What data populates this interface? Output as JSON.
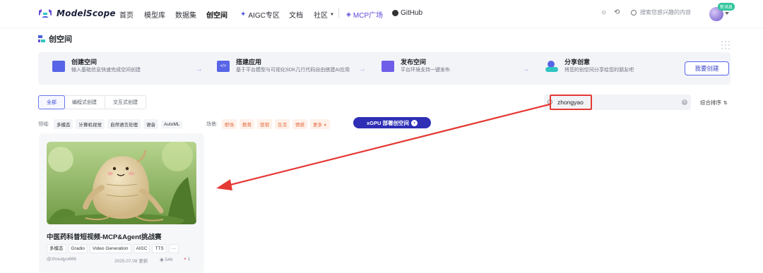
{
  "nav": {
    "brand": "ModelScope",
    "items": [
      {
        "label": "首页"
      },
      {
        "label": "模型库"
      },
      {
        "label": "数据集"
      },
      {
        "label": "创空间"
      },
      {
        "label": "AIGC专区"
      },
      {
        "label": "文档"
      },
      {
        "label": "社区"
      },
      {
        "label": "MCP广场"
      },
      {
        "label": "GitHub"
      }
    ],
    "search_placeholder": "搜索您感兴趣的内容",
    "new_badge": "新消息"
  },
  "page": {
    "title": "创空间"
  },
  "banner": {
    "steps": [
      {
        "title": "创建空间",
        "sub": "输入基础信息快速完成空间创建"
      },
      {
        "title": "搭建应用",
        "sub": "基于平台模型与可视化SDK几行代码自由搭建AI应用"
      },
      {
        "title": "发布空间",
        "sub": "平台环境支持一键发布"
      },
      {
        "title": "分享创意",
        "sub": "将您的创空间分享给您的朋友吧"
      }
    ],
    "create_button": "我要创建"
  },
  "filters": {
    "tabs": [
      "全部",
      "编程式创建",
      "交互式创建"
    ],
    "search_value": "zhongyao",
    "sort_label": "综合排序",
    "domain_label": "领域:",
    "domains": [
      "多模态",
      "计算机视觉",
      "自然语言处理",
      "语音",
      "AutoML"
    ],
    "scene_label": "场景:",
    "scenes": [
      "职场",
      "教育",
      "营销",
      "生活",
      "情感"
    ],
    "more_label": "更多",
    "gpu_button": "xGPU 部署创空间"
  },
  "cards": [
    {
      "title": "中医药科普短视频-MCP&Agent挑战赛",
      "tags": [
        "多模态",
        "Gradio",
        "Video Generation",
        "AIGC",
        "TTS",
        "···"
      ],
      "author": "@zhouqyu666",
      "date": "2025.07.08 更新",
      "views": "546",
      "likes": "1"
    }
  ],
  "colors": {
    "accent": "#3b44c8",
    "annotation": "#e53935",
    "gpu_button": "#2e2fb5"
  }
}
